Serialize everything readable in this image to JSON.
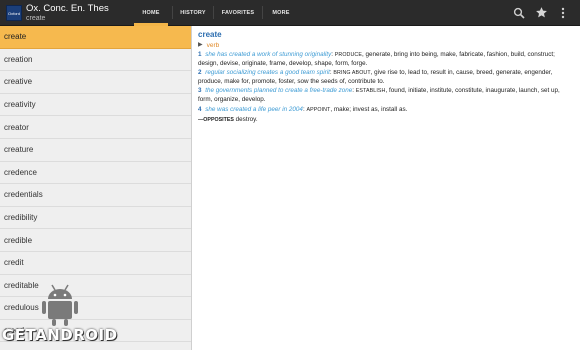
{
  "app": {
    "icon_text": "Oxford",
    "title": "Ox. Conc. En. Thes",
    "subtitle": "create"
  },
  "tabs": [
    {
      "label": "HOME",
      "active": true
    },
    {
      "label": "HISTORY",
      "active": false
    },
    {
      "label": "FAVORITES",
      "active": false
    },
    {
      "label": "MORE",
      "active": false
    }
  ],
  "actions": {
    "icons": [
      "search-icon",
      "star-icon",
      "overflow-menu-icon"
    ]
  },
  "wordlist": {
    "items": [
      "create",
      "creation",
      "creative",
      "creativity",
      "creator",
      "creature",
      "credence",
      "credentials",
      "credibility",
      "credible",
      "credit",
      "creditable",
      "credulous",
      "creed"
    ],
    "selected_index": 0
  },
  "entry": {
    "headword": "create",
    "pos": "verb",
    "senses": [
      {
        "num": "1",
        "example": "she has created a work of stunning originality",
        "first_syn": "PRODUCE",
        "rest": ", generate, bring into being, make, fabricate, fashion, build, construct; design, devise, originate, frame, develop, shape, form, forge."
      },
      {
        "num": "2",
        "example": "regular socializing creates a good team spirit",
        "first_syn": "BRING ABOUT",
        "rest": ", give rise to, lead to, result in, cause, breed, generate, engender, produce, make for, promote, foster, sow the seeds of, contribute to."
      },
      {
        "num": "3",
        "example": "the governments planned to create a free-trade zone",
        "first_syn": "ESTABLISH",
        "rest": ", found, initiate, institute, constitute, inaugurate, launch, set up, form, organize, develop."
      },
      {
        "num": "4",
        "example": "she was created a life peer in 2004",
        "first_syn": "APPOINT",
        "rest": ", make; invest as, install as."
      }
    ],
    "opposites_label": "—OPPOSITES",
    "opposites_text": " destroy."
  },
  "watermark": {
    "text": "GETANDROID"
  },
  "colors": {
    "actionbar": "#2b2b2b",
    "tab_indicator": "#f3b548",
    "selected_row": "#f6b94e",
    "headword": "#2d6eb0",
    "pos": "#e08a2a",
    "example": "#3d9bd4",
    "android_green": "#a4c639"
  }
}
